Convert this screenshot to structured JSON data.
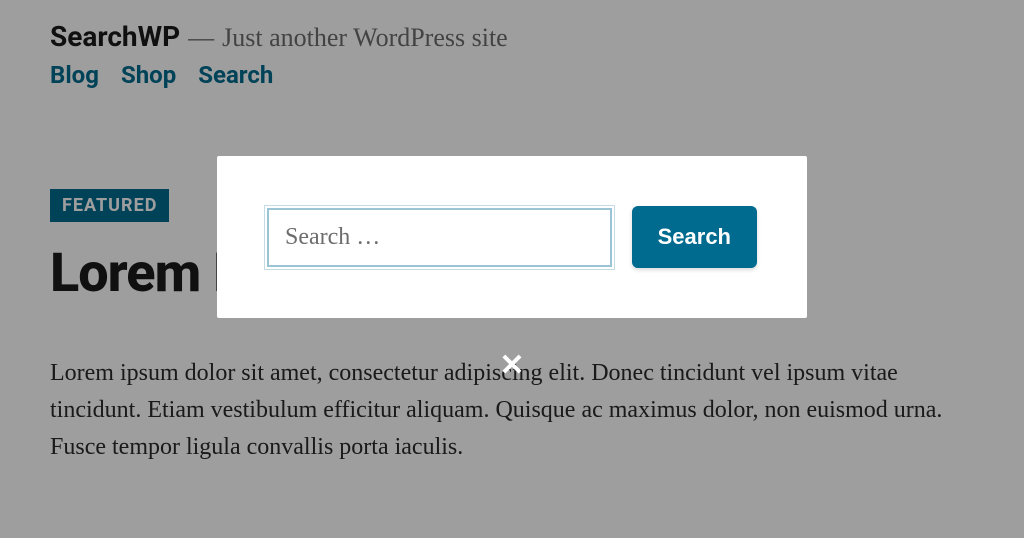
{
  "header": {
    "site_title": "SearchWP",
    "dash": "—",
    "tagline": "Just another WordPress site",
    "nav": [
      {
        "label": "Blog"
      },
      {
        "label": "Shop"
      },
      {
        "label": "Search"
      }
    ]
  },
  "post": {
    "badge": "FEATURED",
    "title": "Lorem Ipsum",
    "body": "Lorem ipsum dolor sit amet, consectetur adipiscing elit. Donec tincidunt vel ipsum vitae tincidunt. Etiam vestibulum efficitur aliquam. Quisque ac maximus dolor, non euismod urna. Fusce tempor ligula convallis porta iaculis."
  },
  "modal": {
    "placeholder": "Search …",
    "button_label": "Search",
    "close_glyph": "✕"
  }
}
